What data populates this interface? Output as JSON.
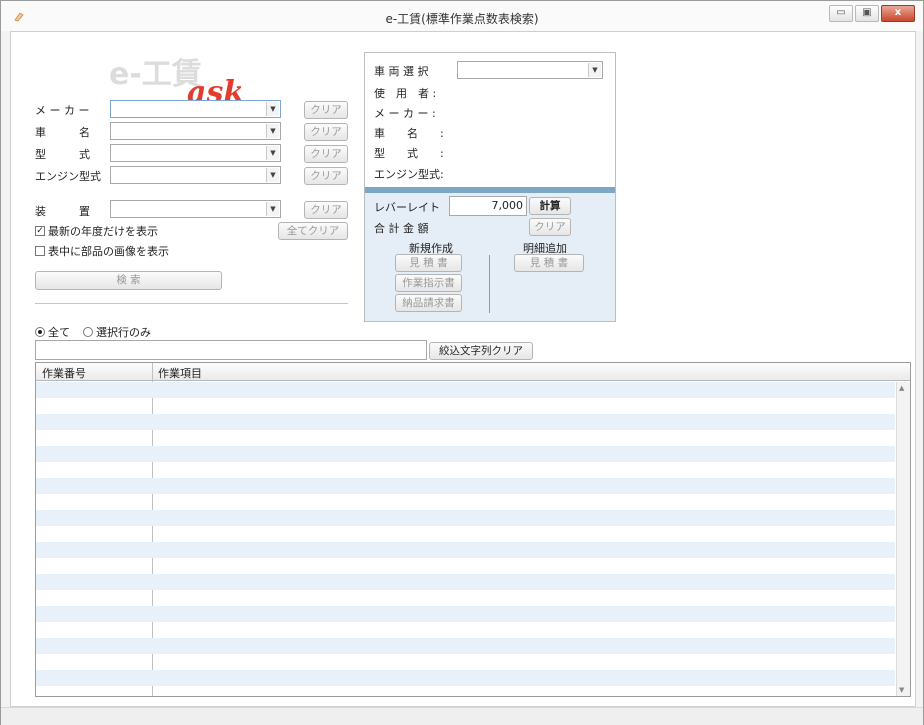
{
  "window": {
    "title": "e-工賃(標準作業点数表検索)",
    "minimize_glyph": "▭",
    "maximize_glyph": "▣",
    "close_glyph": "x"
  },
  "logo": {
    "text_gray": "e-工賃",
    "text_red": "ask"
  },
  "search_form": {
    "maker_label": "メ ー カ ー",
    "car_name_label": "車　　　名",
    "model_label": "型　　　式",
    "engine_label": "エンジン型式",
    "trim_label": "装　　　置",
    "clear_label": "クリア",
    "clear_all_label": "全てクリア",
    "latest_year_label": "最新の年度だけを表示",
    "latest_year_checked": true,
    "show_parts_image_label": "表中に部品の画像を表示",
    "show_parts_image_checked": false,
    "search_button_label": "検 索"
  },
  "vehicle_panel": {
    "vehicle_select_label": "車 両 選 択",
    "user_label": "使　用　者 :",
    "maker_label": "メ ー カ ー :",
    "car_name_label": "車　　名　　:",
    "model_label": "型　　式　　:",
    "engine_label": "エンジン型式:",
    "labor_rate_label": "レバーレイト",
    "labor_rate_value": "7,000",
    "calc_button_label": "計算",
    "total_label": "合 計 金 額",
    "clear_label": "クリア",
    "new_create_label": "新規作成",
    "detail_add_label": "明細追加",
    "estimate_label": "見 積 書",
    "work_order_label": "作業指示書",
    "invoice_label": "納品請求書",
    "estimate2_label": "見 積 書"
  },
  "filter": {
    "all_label": "全て",
    "all_selected": true,
    "selected_only_label": "選択行のみ",
    "input_value": "",
    "clear_filter_label": "絞込文字列クリア"
  },
  "grid": {
    "columns": [
      "作業番号",
      "作業項目"
    ],
    "rows": []
  },
  "colors": {
    "accent_panel": "#7ea7c6",
    "row_alt": "#e8f0fa",
    "logo_red": "#e33b2c"
  }
}
